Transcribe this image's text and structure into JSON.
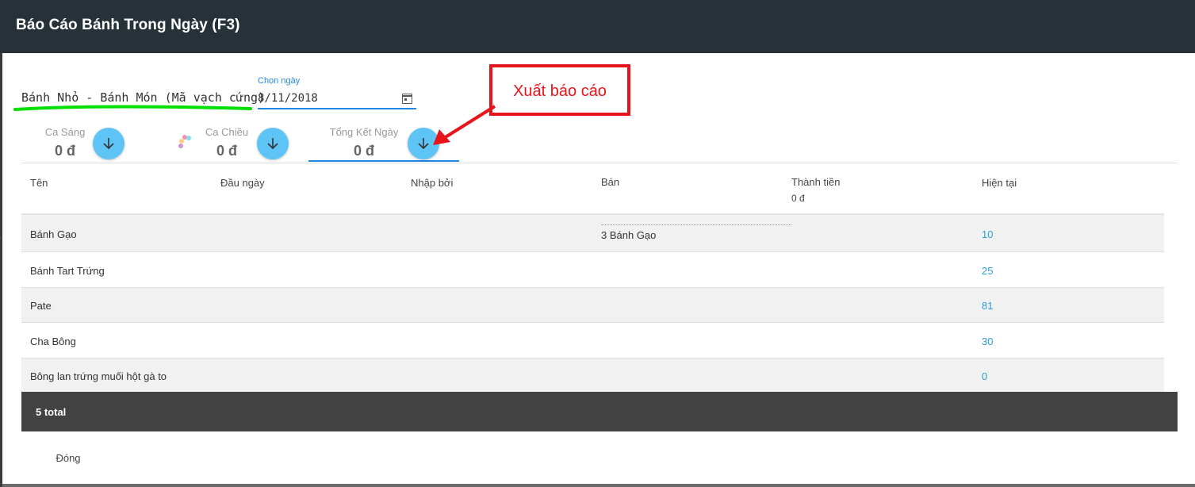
{
  "window": {
    "title": "Báo Cáo Bánh Trong Ngày (F3)"
  },
  "category": {
    "label": "Bánh Nhỏ - Bánh Món (Mã vạch cứng)"
  },
  "date_picker": {
    "caption": "Chọn ngày",
    "value": "8/11/2018"
  },
  "shifts": [
    {
      "label": "Ca Sáng",
      "value": "0 đ"
    },
    {
      "label": "Ca Chiều",
      "value": "0 đ"
    },
    {
      "label": "Tổng Kết Ngày",
      "value": "0 đ"
    }
  ],
  "annotation": {
    "text": "Xuất báo cáo",
    "color": "#e8141b"
  },
  "table": {
    "headers": {
      "name": "Tên",
      "start_of_day": "Đầu ngày",
      "entered_by": "Nhập bởi",
      "sold": "Bán",
      "amount": "Thành tiền",
      "amount_total": "0 đ",
      "current": "Hiện tại"
    },
    "rows": [
      {
        "name": "Bánh Gạo",
        "sold": "3 Bánh Gạo",
        "current": "10"
      },
      {
        "name": "Bánh Tart Trứng",
        "sold": "",
        "current": "25"
      },
      {
        "name": "Pate",
        "sold": "",
        "current": "81"
      },
      {
        "name": "Cha Bông",
        "sold": "",
        "current": "30"
      },
      {
        "name": "Bông lan trứng muối hột gà to",
        "sold": "",
        "current": "0"
      }
    ],
    "footer": "5 total"
  },
  "actions": {
    "close_label": "Đóng"
  },
  "colors": {
    "header_bg": "#263238",
    "accent": "#1e88e5",
    "button": "#5ec3f5",
    "highlight": "#00e000",
    "link": "#2a9fd6"
  }
}
